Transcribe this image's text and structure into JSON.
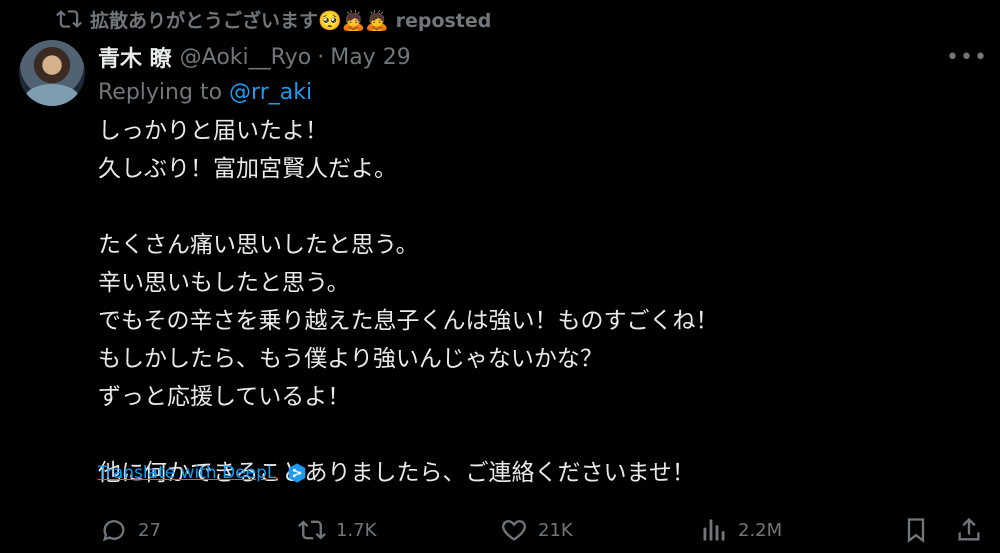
{
  "repost": {
    "label": "拡散ありがとうございます🥺🙇🙇 reposted",
    "icon": "repost-icon"
  },
  "author": {
    "name": "青木 瞭",
    "handle": "@Aoki__Ryo",
    "separator": "·",
    "date": "May 29"
  },
  "more_label": "•••",
  "reply": {
    "prefix": "Replying to",
    "mention": "@rr_aki"
  },
  "body_lines": [
    "しっかりと届いたよ！",
    "久しぶり！富加宮賢人だよ。",
    "",
    "たくさん痛い思いしたと思う。",
    "辛い思いもしたと思う。",
    "でもその辛さを乗り越えた息子くんは強い！ものすごくね！",
    "もしかしたら、もう僕より強いんじゃないかな？",
    "ずっと応援しているよ！",
    "",
    "他に何かできることありましたら、ご連絡くださいませ！"
  ],
  "translate_label": "Translate with DeepL",
  "actions": {
    "replies": "27",
    "reposts": "1.7K",
    "likes": "21K",
    "views": "2.2M"
  },
  "colors": {
    "background": "#000000",
    "text": "#e7e9ea",
    "muted": "#71767b",
    "link": "#1d9bf0"
  }
}
